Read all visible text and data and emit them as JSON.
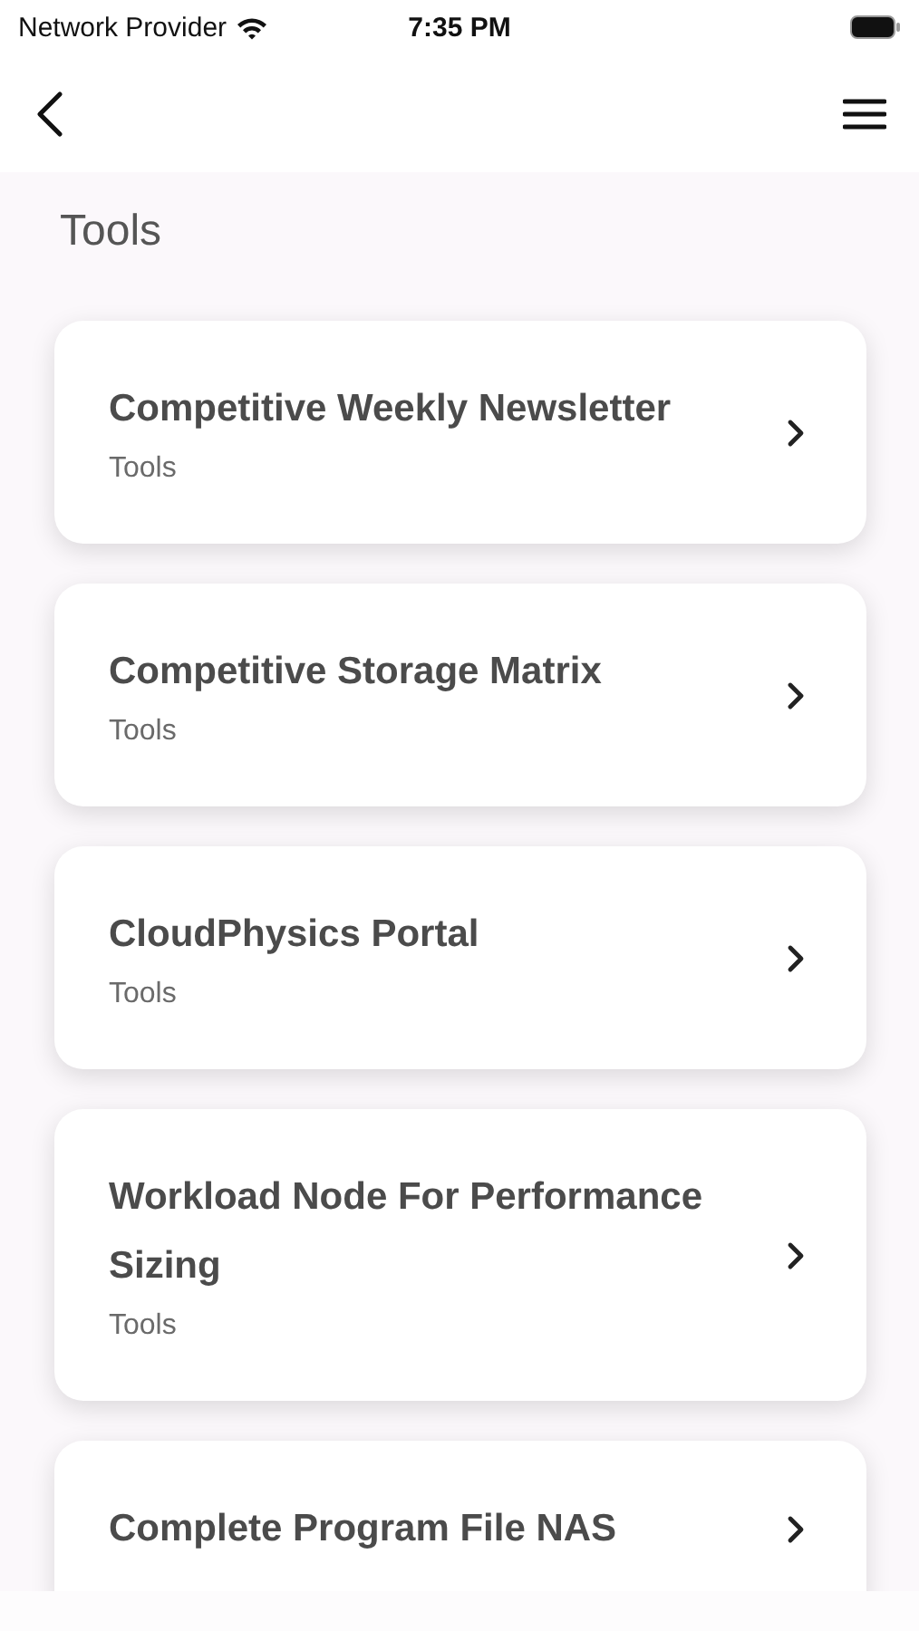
{
  "status_bar": {
    "carrier": "Network Provider",
    "time": "7:35 PM"
  },
  "page": {
    "title": "Tools"
  },
  "items": [
    {
      "title": "Competitive Weekly Newsletter",
      "subtitle": "Tools"
    },
    {
      "title": "Competitive Storage Matrix",
      "subtitle": "Tools"
    },
    {
      "title": "CloudPhysics Portal",
      "subtitle": "Tools"
    },
    {
      "title": "Workload Node For Performance Sizing",
      "subtitle": "Tools"
    },
    {
      "title": "Complete Program File NAS"
    }
  ]
}
